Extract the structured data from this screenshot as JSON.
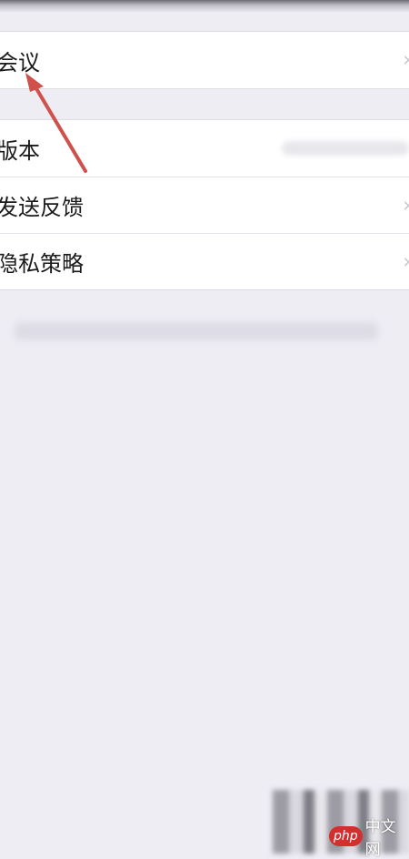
{
  "settings": {
    "group1": [
      {
        "label": "会议",
        "chevron": "›"
      }
    ],
    "group2": [
      {
        "label": "版本"
      },
      {
        "label": "发送反馈",
        "chevron": "›"
      },
      {
        "label": "隐私策略",
        "chevron": "›"
      }
    ]
  },
  "annotation": {
    "arrow_color": "#d0504b"
  },
  "watermark": {
    "badge": "php",
    "text": "中文网"
  }
}
